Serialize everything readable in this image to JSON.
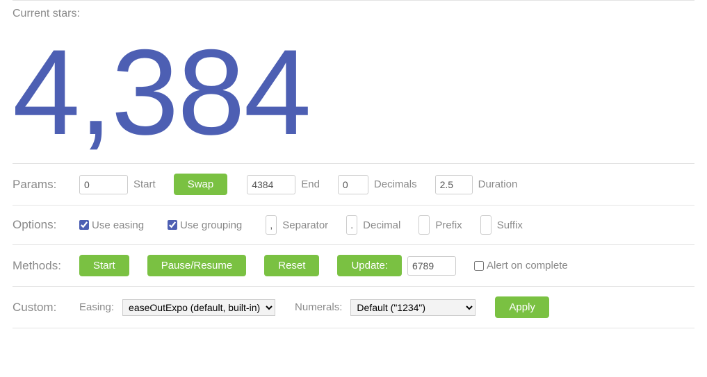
{
  "current_stars_label": "Current stars:",
  "big_value": "4,384",
  "params": {
    "label": "Params:",
    "start_value": "0",
    "start_label": "Start",
    "swap_label": "Swap",
    "end_value": "4384",
    "end_label": "End",
    "decimals_value": "0",
    "decimals_label": "Decimals",
    "duration_value": "2.5",
    "duration_label": "Duration"
  },
  "options": {
    "label": "Options:",
    "use_easing_label": "Use easing",
    "use_easing_checked": true,
    "use_grouping_label": "Use grouping",
    "use_grouping_checked": true,
    "separator_value": ",",
    "separator_label": "Separator",
    "decimal_value": ".",
    "decimal_label": "Decimal",
    "prefix_value": "",
    "prefix_label": "Prefix",
    "suffix_value": "",
    "suffix_label": "Suffix"
  },
  "methods": {
    "label": "Methods:",
    "start_label": "Start",
    "pause_resume_label": "Pause/Resume",
    "reset_label": "Reset",
    "update_label": "Update:",
    "update_value": "6789",
    "alert_label": "Alert on complete",
    "alert_checked": false
  },
  "custom": {
    "label": "Custom:",
    "easing_label": "Easing:",
    "easing_selected": "easeOutExpo (default, built-in)",
    "numerals_label": "Numerals:",
    "numerals_selected": "Default (\"1234\")",
    "apply_label": "Apply"
  }
}
